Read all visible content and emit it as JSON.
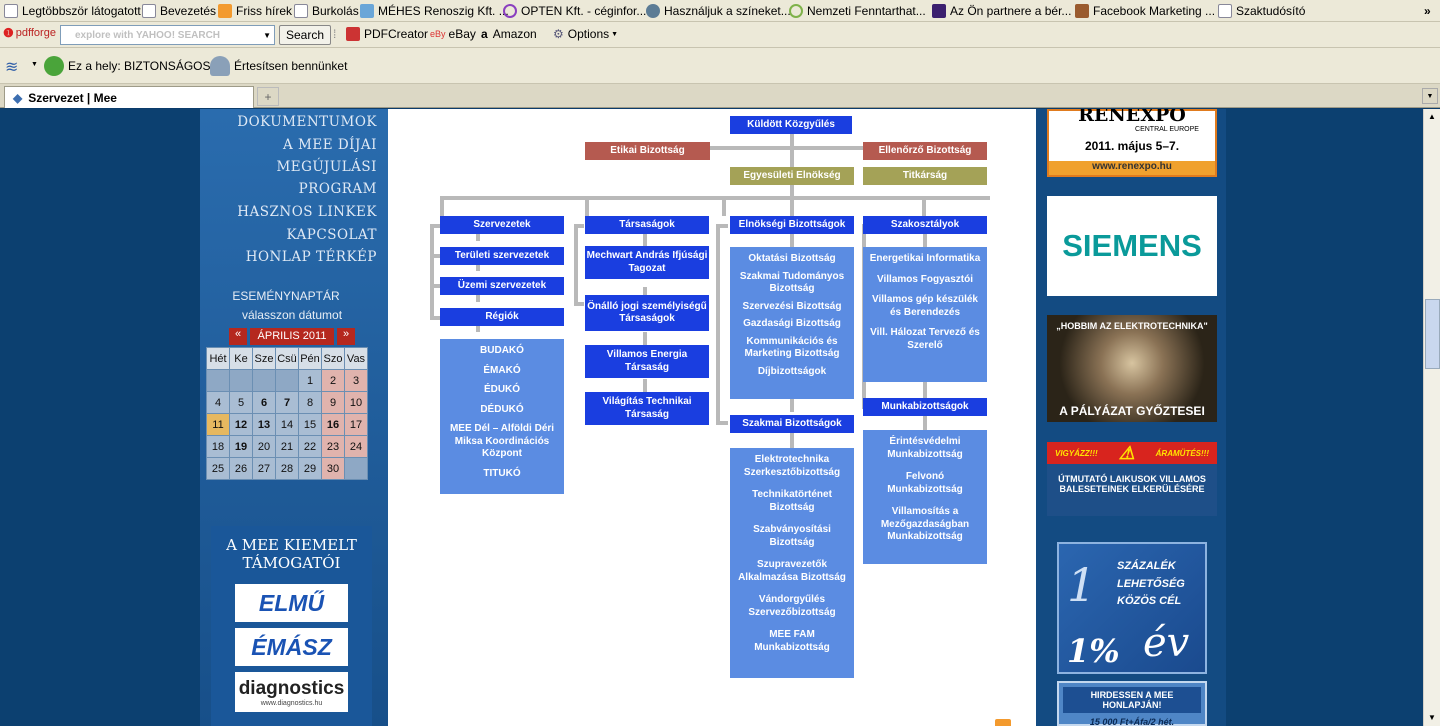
{
  "bookmarks": [
    {
      "label": "Legtöbbször látogatott"
    },
    {
      "label": "Bevezetés"
    },
    {
      "label": "Friss hírek"
    },
    {
      "label": "Burkolás"
    },
    {
      "label": "MÉHES Renoszig Kft. ..."
    },
    {
      "label": "OPTEN Kft. - céginfor..."
    },
    {
      "label": "Használjuk a színeket..."
    },
    {
      "label": "Nemzeti Fenntarthat..."
    },
    {
      "label": "Az Ön partnere a bér..."
    },
    {
      "label": "Facebook Marketing ..."
    },
    {
      "label": "Szaktudósító"
    }
  ],
  "toolbar": {
    "brand": "pdfforge",
    "search_placeholder": "explore with YAHOO! SEARCH",
    "search_button": "Search",
    "pdfcreator": "PDFCreator",
    "ebay": "eBay",
    "amazon": "Amazon",
    "options": "Options"
  },
  "security": {
    "status": "Ez a hely: BIZTONSÁGOS",
    "notify": "Értesítsen bennünket"
  },
  "tab": {
    "title": "Szervezet | Mee"
  },
  "nav": [
    "DOKUMENTUMOK",
    "A MEE DÍJAI",
    "MEGÚJULÁSI",
    "PROGRAM",
    "HASZNOS LINKEK",
    "KAPCSOLAT",
    "HONLAP TÉRKÉP"
  ],
  "calendar": {
    "title": "ESEMÉNYNAPTÁR",
    "subtitle": "válasszon dátumot",
    "prev": "«",
    "next": "»",
    "month": "ÁPRILIS 2011",
    "days": [
      "Hét",
      "Ke",
      "Sze",
      "Csü",
      "Pén",
      "Szo",
      "Vas"
    ],
    "rows": [
      [
        "",
        "",
        "",
        "",
        "1",
        "2",
        "3"
      ],
      [
        "4",
        "5",
        "6",
        "7",
        "8",
        "9",
        "10"
      ],
      [
        "11",
        "12",
        "13",
        "14",
        "15",
        "16",
        "17"
      ],
      [
        "18",
        "19",
        "20",
        "21",
        "22",
        "23",
        "24"
      ],
      [
        "25",
        "26",
        "27",
        "28",
        "29",
        "30",
        ""
      ]
    ]
  },
  "sponsors": {
    "title_line1": "A MEE KIEMELT",
    "title_line2": "TÁMOGATÓI",
    "logos": [
      "ELMŰ",
      "ÉMÁSZ",
      "diagnostics"
    ],
    "diag_sub": "www.diagnostics.hu"
  },
  "org": {
    "top": "Küldött Közgyűlés",
    "etikai": "Etikai Bizottság",
    "ellenorzo": "Ellenőrző Bizottság",
    "elnokseg": "Egyesületi Elnökség",
    "titkarsag": "Titkárság",
    "col1": {
      "head": "Szervezetek",
      "items": [
        "Területi szervezetek",
        "Üzemi szervezetek"
      ],
      "regiok": "Régiók",
      "regiok_list": [
        "BUDAKÓ",
        "ÉMAKÓ",
        "ÉDUKÓ",
        "DÉDUKÓ",
        "MEE Dél – Alföldi Déri Miksa Koordinációs Központ",
        "TITUKÓ"
      ]
    },
    "col2": {
      "head": "Társaságok",
      "items": [
        "Mechwart András Ifjúsági Tagozat",
        "Önálló jogi személyiségű Társaságok",
        "Villamos Energia Társaság",
        "Világítás Technikai Társaság"
      ]
    },
    "col3": {
      "head": "Elnökségi Bizottságok",
      "list": [
        "Oktatási Bizottság",
        "Szakmai Tudományos Bizottság",
        "Szervezési Bizottság",
        "Gazdasági Bizottság",
        "Kommunikációs és Marketing Bizottság",
        "Díjbizottságok"
      ],
      "head2": "Szakmai Bizottságok",
      "list2": [
        "Elektrotechnika Szerkesztőbizottság",
        "Technikatörténet Bizottság",
        "Szabványosítási Bizottság",
        "Szupravezetők Alkalmazása Bizottság",
        "Vándorgyűlés Szervezőbizottság",
        "MEE FAM Munkabizottság"
      ]
    },
    "col4": {
      "head": "Szakosztályok",
      "list": [
        "Energetikai Informatika",
        "Villamos Fogyasztói",
        "Villamos gép készülék és Berendezés",
        "Vill. Hálozat Tervező és Szerelő"
      ],
      "head2": "Munkabizottságok",
      "list2": [
        "Érintésvédelmi Munkabizottság",
        "Felvonó Munkabizottság",
        "Villamosítás a Mezőgazdaságban Munkabizottság"
      ]
    }
  },
  "ads": {
    "renexpo_title": "RENEXPO",
    "renexpo_sub": "CENTRAL EUROPE",
    "renexpo_date": "2011. május 5–7.",
    "renexpo_url": "www.renexpo.hu",
    "siemens": "SIEMENS",
    "hobbim_title": "„HOBBIM AZ ELEKTROTECHNIKA\"",
    "hobbim_bottom": "A PÁLYÁZAT GYŐZTESEI",
    "vigyazz_top": "VIGYÁZZ!!!",
    "vigyazz_top2": "ÁRAMÜTÉS!!!",
    "vigyazz_text": "ÚTMUTATÓ LAIKUSOK VILLAMOS BALESETEINEK ELKERÜLÉSÉRE",
    "szazalek_words": "SZÁZALÉK LEHETŐSÉG KÖZÖS CÉL",
    "szazalek_1": "1",
    "szazalek_pct": "1%",
    "szazalek_ev": "év",
    "hirdessen": "HIRDESSEN A MEE HONLAPJÁN!",
    "hirdessen_price": "15 000 Ft+Áfa/2 hét."
  }
}
